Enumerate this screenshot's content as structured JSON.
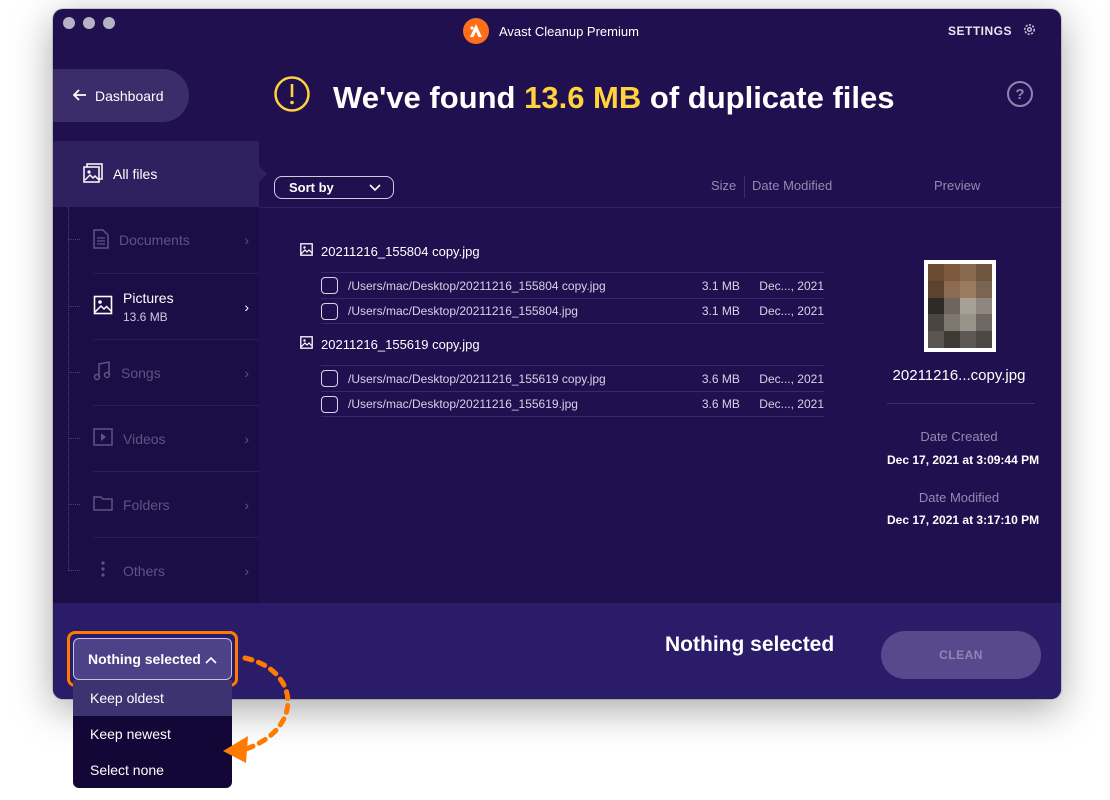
{
  "app": {
    "title": "Avast Cleanup Premium",
    "settings_label": "SETTINGS"
  },
  "header": {
    "dashboard_label": "Dashboard",
    "headline_prefix": "We've found",
    "headline_size": "13.6 MB",
    "headline_suffix": "of duplicate files",
    "help_symbol": "?"
  },
  "sidebar": {
    "all_files": "All files",
    "items": [
      {
        "label": "Documents",
        "icon": "document-icon"
      },
      {
        "label": "Pictures",
        "sub": "13.6 MB",
        "icon": "picture-icon"
      },
      {
        "label": "Songs",
        "icon": "music-note-icon"
      },
      {
        "label": "Videos",
        "icon": "video-icon"
      },
      {
        "label": "Folders",
        "icon": "folder-icon"
      },
      {
        "label": "Others",
        "icon": "more-vertical-icon"
      }
    ]
  },
  "toolbar": {
    "sort_label": "Sort by",
    "col_size": "Size",
    "col_date": "Date Modified",
    "col_preview": "Preview"
  },
  "groups": [
    {
      "name": "20211216_155804 copy.jpg",
      "files": [
        {
          "path": "/Users/mac/Desktop/20211216_155804 copy.jpg",
          "size": "3.1 MB",
          "date": "Dec..., 2021"
        },
        {
          "path": "/Users/mac/Desktop/20211216_155804.jpg",
          "size": "3.1 MB",
          "date": "Dec..., 2021"
        }
      ]
    },
    {
      "name": "20211216_155619 copy.jpg",
      "files": [
        {
          "path": "/Users/mac/Desktop/20211216_155619 copy.jpg",
          "size": "3.6 MB",
          "date": "Dec..., 2021"
        },
        {
          "path": "/Users/mac/Desktop/20211216_155619.jpg",
          "size": "3.6 MB",
          "date": "Dec..., 2021"
        }
      ]
    }
  ],
  "preview": {
    "filename": "20211216...copy.jpg",
    "date_created_label": "Date Created",
    "date_created": "Dec 17, 2021 at 3:09:44 PM",
    "date_modified_label": "Date Modified",
    "date_modified": "Dec 17, 2021 at 3:17:10 PM"
  },
  "footer": {
    "status": "Nothing selected",
    "clean_label": "CLEAN"
  },
  "dropdown": {
    "selected": "Nothing selected",
    "options": [
      "Keep oldest",
      "Keep newest",
      "Select none"
    ],
    "highlighted_index": 0
  },
  "colors": {
    "background": "#21104f",
    "accent_yellow": "#ffd33d",
    "brand_orange": "#ff6e1b",
    "highlight_orange": "#ff7a00"
  }
}
